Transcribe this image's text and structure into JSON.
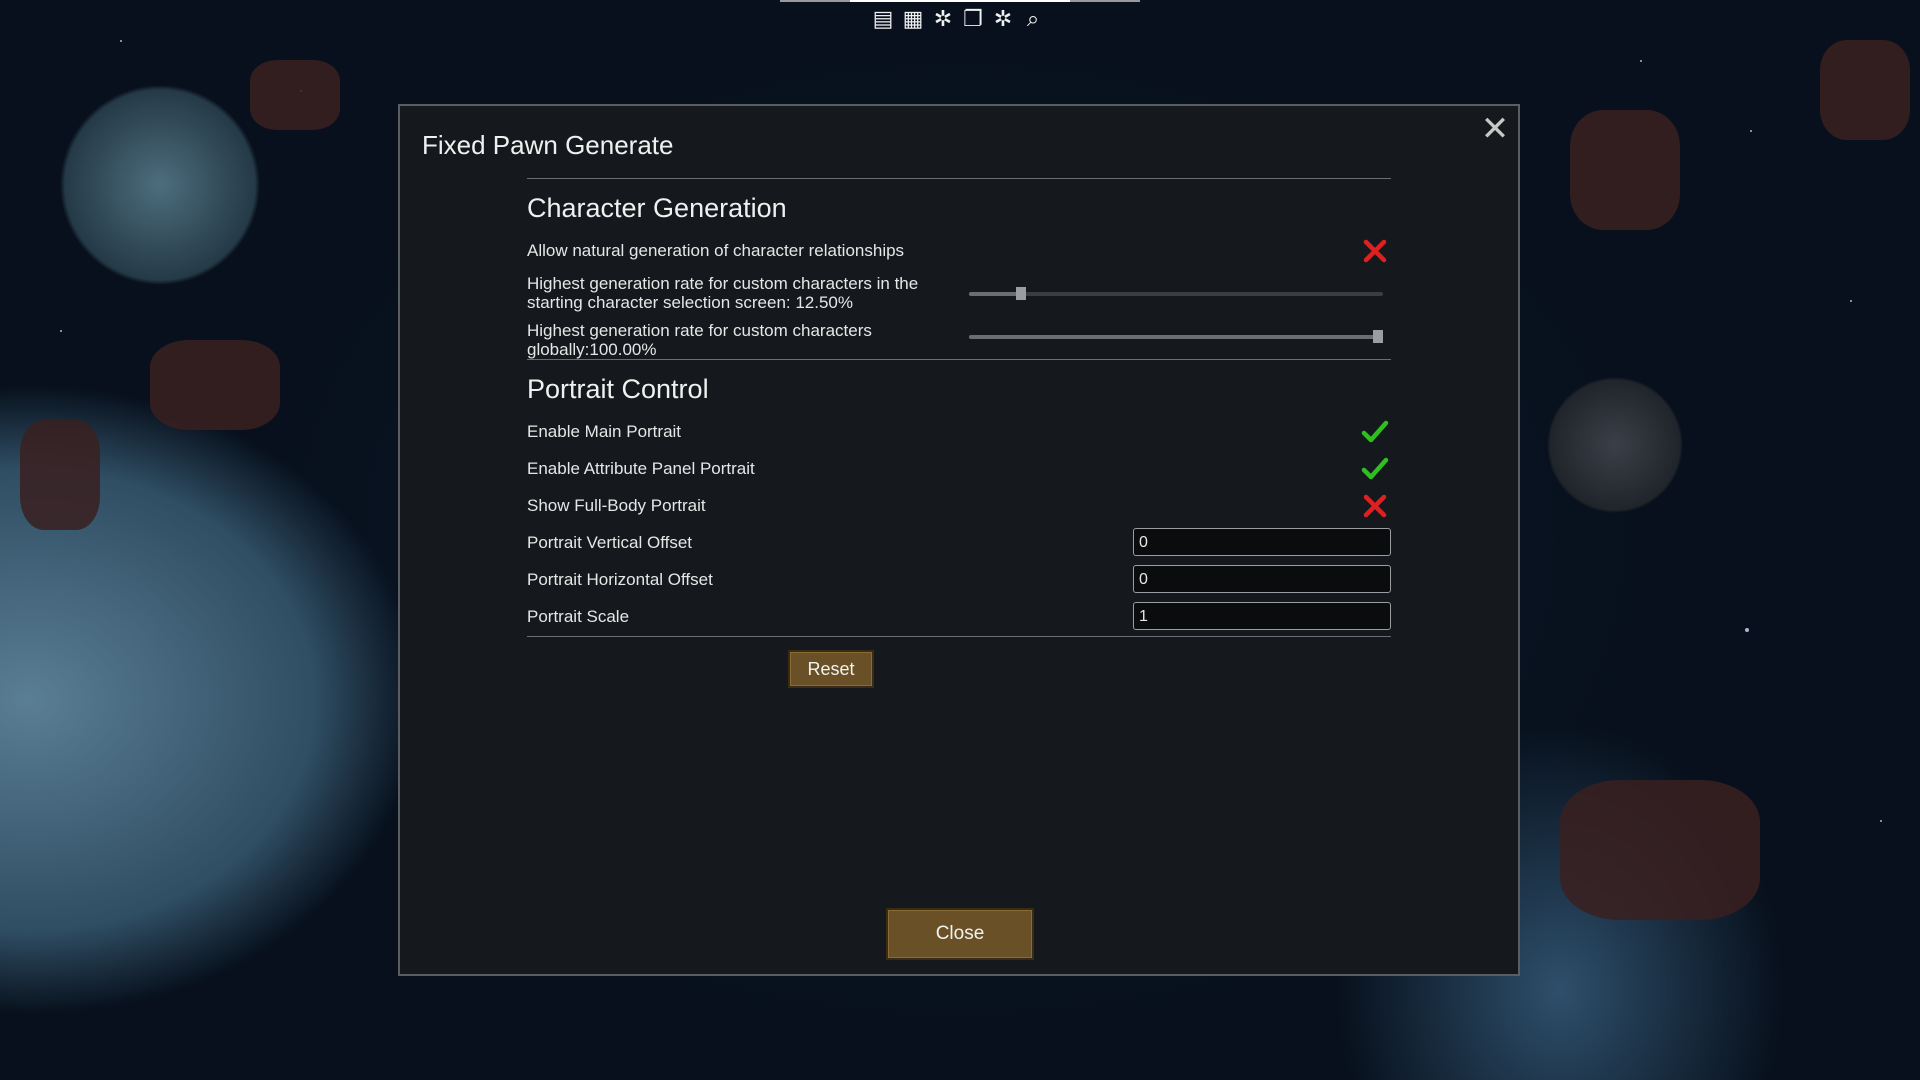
{
  "toolbar": {
    "icons": [
      "log-icon",
      "table-icon",
      "debug-spark-icon",
      "copy-icon",
      "debug-spark-icon-2",
      "search-icon"
    ],
    "glyphs": [
      "▤",
      "▦",
      "✲",
      "❐",
      "✲",
      "⌕"
    ]
  },
  "dialog": {
    "title": "Fixed Pawn Generate",
    "close_glyph": "✕"
  },
  "character_generation": {
    "heading": "Character Generation",
    "allow_relationships": {
      "label": "Allow natural generation of character relationships",
      "enabled": false
    },
    "start_rate": {
      "label": "Highest generation rate for custom characters in the starting character selection screen: 12.50%",
      "value_pct": 12.5
    },
    "global_rate": {
      "label": "Highest generation rate for custom characters globally:100.00%",
      "value_pct": 100.0
    }
  },
  "portrait_control": {
    "heading": "Portrait Control",
    "enable_main": {
      "label": "Enable Main Portrait",
      "enabled": true
    },
    "enable_attribute": {
      "label": "Enable Attribute Panel Portrait",
      "enabled": true
    },
    "show_full_body": {
      "label": "Show Full-Body Portrait",
      "enabled": false
    },
    "vertical_offset": {
      "label": "Portrait Vertical Offset",
      "value": "0"
    },
    "horizontal_offset": {
      "label": "Portrait Horizontal Offset",
      "value": "0"
    },
    "scale": {
      "label": "Portrait Scale",
      "value": "1"
    }
  },
  "buttons": {
    "reset": "Reset",
    "close": "Close"
  },
  "colors": {
    "check": "#2ec01e",
    "cross": "#e02020",
    "button_bg": "#6a5027"
  }
}
